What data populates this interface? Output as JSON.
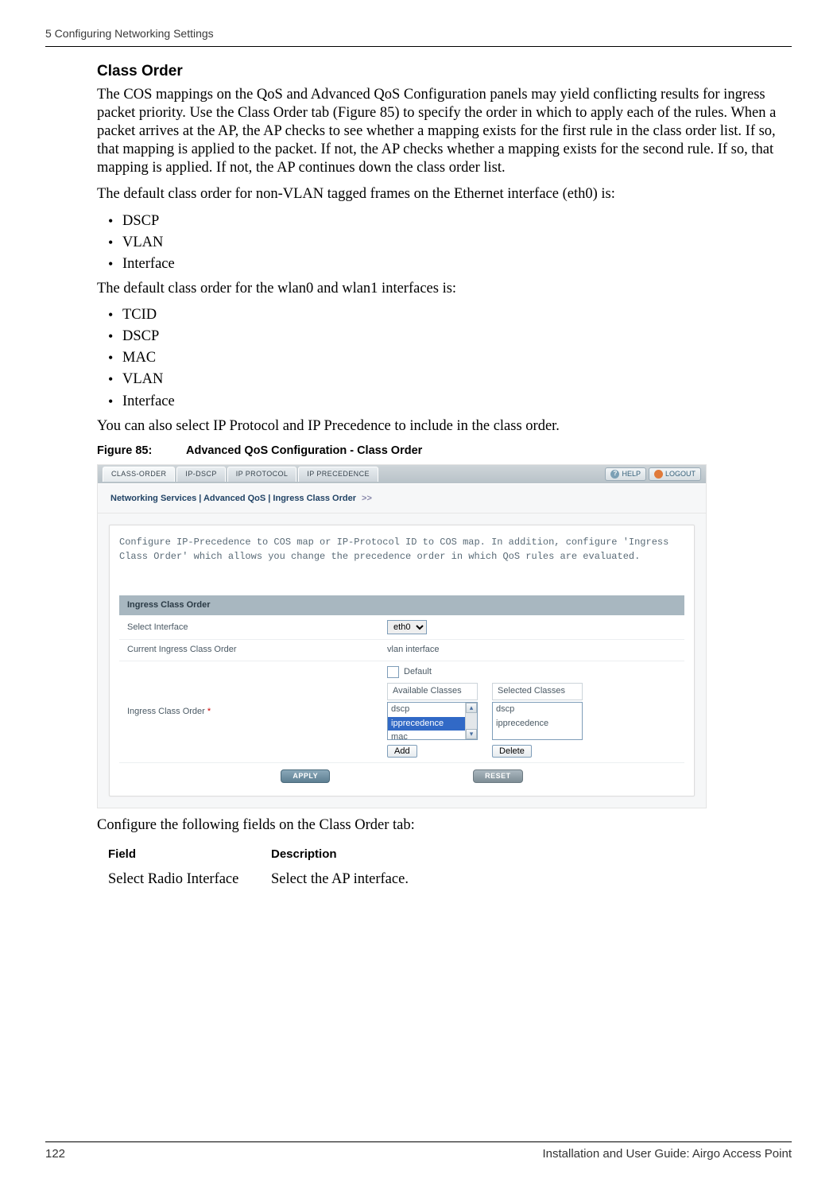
{
  "header": {
    "left": "5  Configuring Networking Settings"
  },
  "section": {
    "title": "Class Order",
    "para1": "The COS mappings on the QoS and Advanced QoS Configuration panels may yield conflicting results for ingress packet priority. Use the Class Order tab (Figure 85) to specify the order in which to apply each of the rules. When a packet arrives at the AP, the AP checks to see whether a mapping exists for the first rule in the class order list. If so, that mapping is applied to the packet. If not, the AP checks whether a mapping exists for the second rule. If so, that mapping is applied. If not, the AP continues down the class order list.",
    "para2": "The default class order for non-VLAN tagged frames on the Ethernet interface (eth0) is:",
    "list1": [
      "DSCP",
      "VLAN",
      "Interface"
    ],
    "para3": "The default class order for the wlan0 and wlan1 interfaces is:",
    "list2": [
      "TCID",
      "DSCP",
      "MAC",
      "VLAN",
      "Interface"
    ],
    "para4": "You can also select IP Protocol and IP Precedence to include in the class order."
  },
  "figure": {
    "label": "Figure 85:",
    "caption": "Advanced QoS Configuration - Class Order"
  },
  "shot": {
    "tabs": [
      "CLASS-ORDER",
      "IP-DSCP",
      "IP PROTOCOL",
      "IP PRECEDENCE"
    ],
    "help": "HELP",
    "logout": "LOGOUT",
    "breadcrumb": "Networking Services | Advanced QoS | Ingress Class Order",
    "breadcrumb_arrow": ">>",
    "desc": "Configure IP-Precedence to COS map or IP-Protocol ID to COS map. In addition, configure 'Ingress Class Order' which allows you change the precedence order in which QoS rules are evaluated.",
    "section_title": "Ingress Class Order",
    "rows": {
      "select_if_label": "Select Interface",
      "select_if_value": "eth0",
      "current_label": "Current Ingress Class Order",
      "current_value": "vlan interface",
      "order_label": "Ingress Class Order",
      "default_label": "Default",
      "avail_title": "Available Classes",
      "sel_title": "Selected Classes",
      "avail_items": [
        "dscp",
        "ipprecedence",
        "mac"
      ],
      "sel_items": [
        "dscp",
        "ipprecedence"
      ],
      "add_btn": "Add",
      "del_btn": "Delete"
    },
    "apply": "APPLY",
    "reset": "RESET"
  },
  "after_figure": "Configure the following fields on the Class Order tab:",
  "table": {
    "h1": "Field",
    "h2": "Description",
    "r1c1": "Select Radio Interface",
    "r1c2": "Select the AP interface."
  },
  "footer": {
    "left": "122",
    "right": "Installation and User Guide: Airgo Access Point"
  }
}
